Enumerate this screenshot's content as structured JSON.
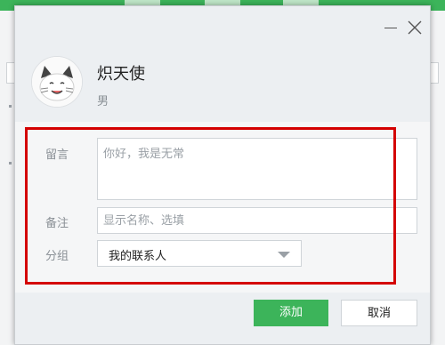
{
  "dialog": {
    "contact": {
      "name": "炽天使",
      "gender": "男"
    },
    "fields": {
      "message_label": "留言",
      "message_placeholder": "你好，我是无常",
      "remark_label": "备注",
      "remark_placeholder": "显示名称、选填",
      "group_label": "分组",
      "group_value": "我的联系人"
    },
    "buttons": {
      "add": "添加",
      "cancel": "取消"
    }
  },
  "colors": {
    "accent": "#3cb45a",
    "highlight": "#d40000"
  }
}
